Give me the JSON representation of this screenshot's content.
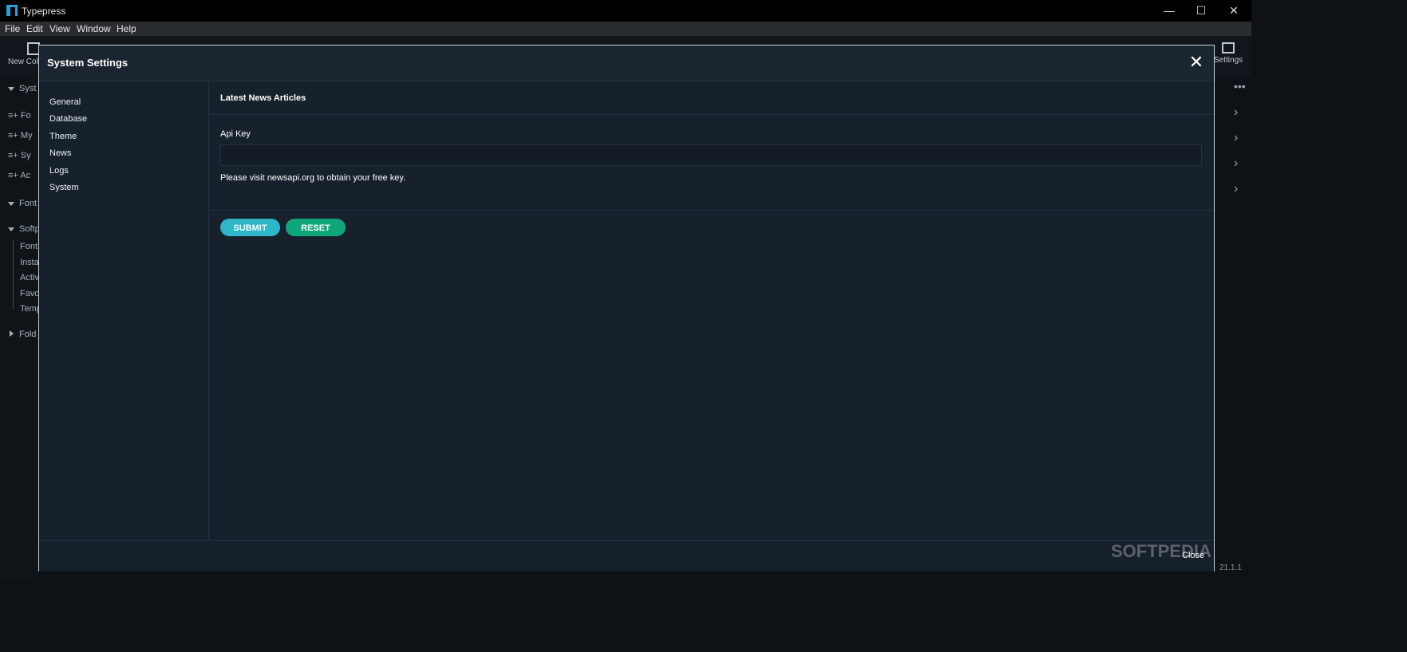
{
  "app": {
    "title": "Typepress",
    "version": "21.1.1"
  },
  "window_controls": {
    "minimize": "—",
    "maximize": "☐",
    "close": "✕"
  },
  "menu": [
    "File",
    "Edit",
    "View",
    "Window",
    "Help"
  ],
  "toolbar": {
    "new_collection": "New Coll",
    "settings": "Settings"
  },
  "sidebar": {
    "rows": [
      {
        "label": "Syst",
        "type": "group"
      },
      {
        "label": "Fo",
        "type": "list"
      },
      {
        "label": "My",
        "type": "list"
      },
      {
        "label": "Sy",
        "type": "list"
      },
      {
        "label": "Ac",
        "type": "list"
      },
      {
        "label": "Font",
        "type": "group"
      },
      {
        "label": "Softp",
        "type": "group"
      },
      {
        "label": "Font",
        "type": "child"
      },
      {
        "label": "Insta",
        "type": "child"
      },
      {
        "label": "Activ",
        "type": "child"
      },
      {
        "label": "Favo",
        "type": "child"
      },
      {
        "label": "Temp",
        "type": "child"
      },
      {
        "label": "Fold",
        "type": "group-collapsed"
      }
    ]
  },
  "dialog": {
    "title": "System Settings",
    "close_glyph": "✕",
    "nav": [
      "General",
      "Database",
      "Theme",
      "News",
      "Logs",
      "System"
    ],
    "section_title": "Latest News Articles",
    "api_key_label": "Api Key",
    "api_key_value": "",
    "help_text": "Please visit newsapi.org to obtain your free key.",
    "submit_label": "SUBMIT",
    "reset_label": "RESET",
    "footer_close_label": "Close"
  },
  "watermark": "SOFTPEDIA",
  "colors": {
    "submit": "#2fb6c8",
    "reset": "#10a67c",
    "dialog_bg": "#16202a"
  }
}
